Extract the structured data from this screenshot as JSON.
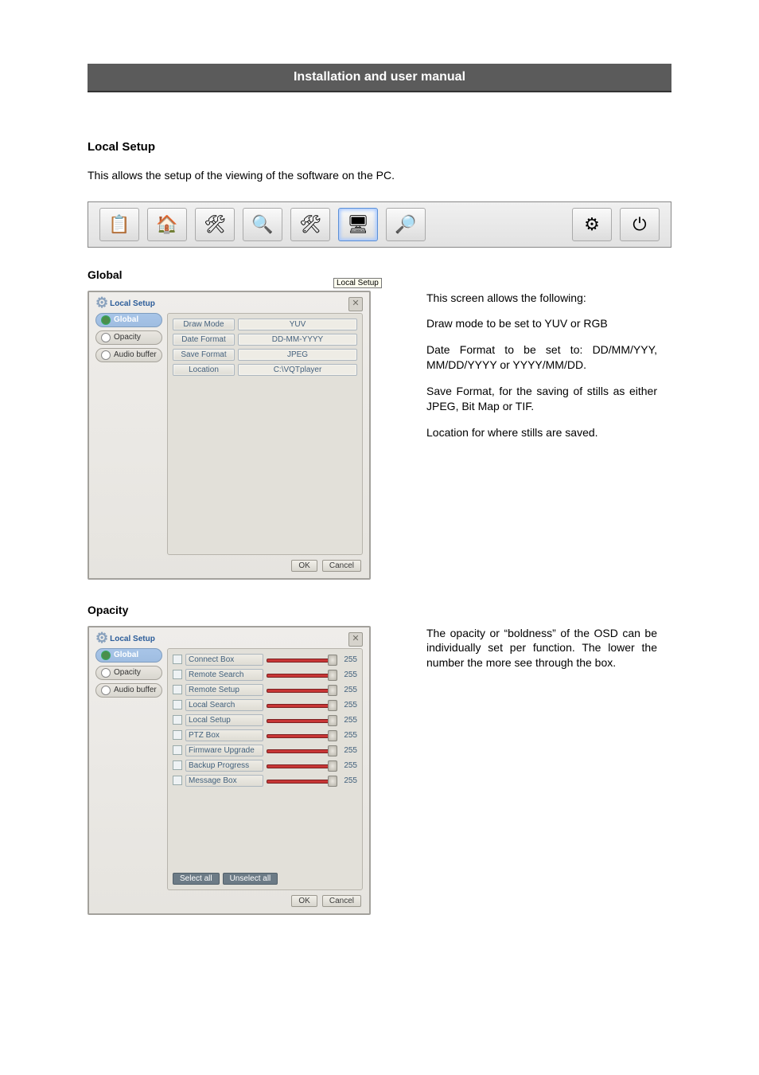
{
  "header": {
    "title": "Installation and user manual"
  },
  "section": {
    "title": "Local Setup",
    "intro": "This allows the setup of the viewing of the software on the PC."
  },
  "toolbar": {
    "icons": [
      {
        "name": "list-icon",
        "glyph": "📋"
      },
      {
        "name": "group-icon",
        "glyph": "🏠"
      },
      {
        "name": "tools-icon",
        "glyph": "🛠"
      },
      {
        "name": "search-list-icon",
        "glyph": "🔍"
      },
      {
        "name": "tools2-icon",
        "glyph": "🛠"
      },
      {
        "name": "monitor-icon",
        "glyph": "🖥"
      },
      {
        "name": "search-icon",
        "glyph": "🔎"
      },
      {
        "name": "gear-icon",
        "glyph": "⚙"
      },
      {
        "name": "power-icon",
        "glyph": "⏻"
      }
    ],
    "tooltip": "Local Setup"
  },
  "global": {
    "heading": "Global",
    "dialog_title": "Local Setup",
    "tabs": [
      "Global",
      "Opacity",
      "Audio buffer"
    ],
    "fields": [
      {
        "label": "Draw Mode",
        "value": "YUV"
      },
      {
        "label": "Date Format",
        "value": "DD-MM-YYYY"
      },
      {
        "label": "Save Format",
        "value": "JPEG"
      },
      {
        "label": "Location",
        "value": "C:\\VQTplayer"
      }
    ],
    "ok": "OK",
    "cancel": "Cancel",
    "text": [
      "This screen allows the following:",
      "Draw mode to be set to YUV or RGB",
      "Date Format to be set to: DD/MM/YYY, MM/DD/YYYY or YYYY/MM/DD.",
      "Save Format, for the saving of stills as either JPEG, Bit Map or TIF.",
      "Location for where stills are saved."
    ]
  },
  "opacity": {
    "heading": "Opacity",
    "dialog_title": "Local Setup",
    "tabs": [
      "Global",
      "Opacity",
      "Audio buffer"
    ],
    "items": [
      {
        "label": "Connect Box",
        "value": 255
      },
      {
        "label": "Remote Search",
        "value": 255
      },
      {
        "label": "Remote Setup",
        "value": 255
      },
      {
        "label": "Local Search",
        "value": 255
      },
      {
        "label": "Local Setup",
        "value": 255
      },
      {
        "label": "PTZ Box",
        "value": 255
      },
      {
        "label": "Firmware Upgrade",
        "value": 255
      },
      {
        "label": "Backup Progress",
        "value": 255
      },
      {
        "label": "Message Box",
        "value": 255
      }
    ],
    "select_all": "Select all",
    "unselect_all": "Unselect all",
    "ok": "OK",
    "cancel": "Cancel",
    "text": [
      "The opacity or “boldness” of the OSD can be individually set per function. The lower the number the more see through the box."
    ]
  }
}
